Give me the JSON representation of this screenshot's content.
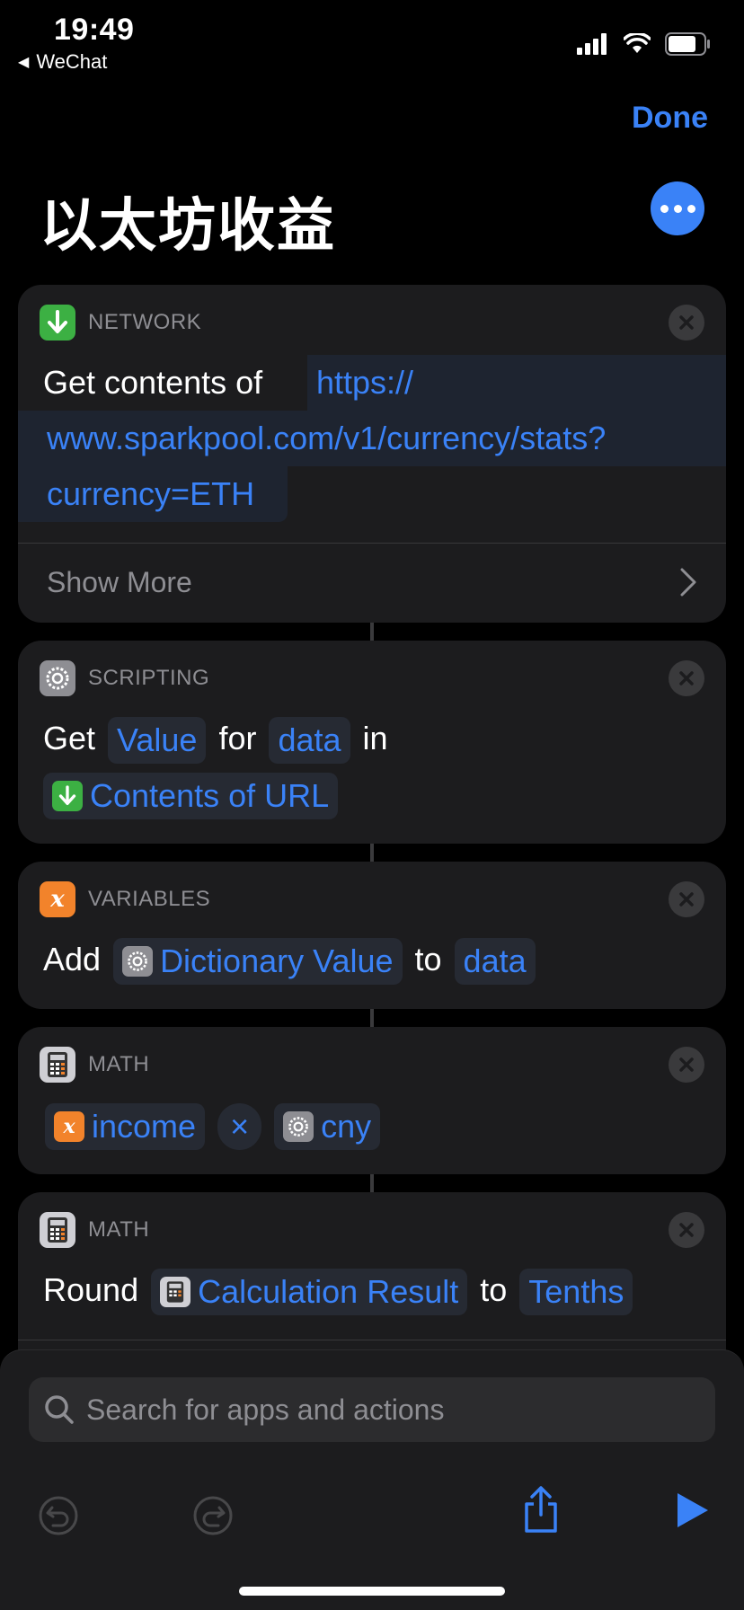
{
  "status_bar": {
    "time": "19:49",
    "back_app": "WeChat"
  },
  "nav": {
    "done_label": "Done",
    "title": "以太坊收益"
  },
  "actions": [
    {
      "category": "NETWORK",
      "verb": "Get contents of",
      "url_lines": [
        "https://",
        "www.sparkpool.com/v1/currency/stats?",
        "currency=ETH"
      ],
      "show_more": "Show More"
    },
    {
      "category": "SCRIPTING",
      "words": [
        "Get",
        "for",
        "in"
      ],
      "tokens": [
        "Value",
        "data",
        "Contents of URL"
      ]
    },
    {
      "category": "VARIABLES",
      "words": [
        "Add",
        "to"
      ],
      "tokens": [
        "Dictionary Value",
        "data"
      ]
    },
    {
      "category": "MATH",
      "tokens": [
        "income",
        "×",
        "cny"
      ]
    },
    {
      "category": "MATH",
      "words": [
        "Round",
        "to"
      ],
      "tokens": [
        "Calculation Result",
        "Tenths"
      ]
    }
  ],
  "search": {
    "placeholder": "Search for apps and actions"
  },
  "colors": {
    "accent": "#3a82f7",
    "card": "#1c1c1e",
    "background": "#000000"
  }
}
